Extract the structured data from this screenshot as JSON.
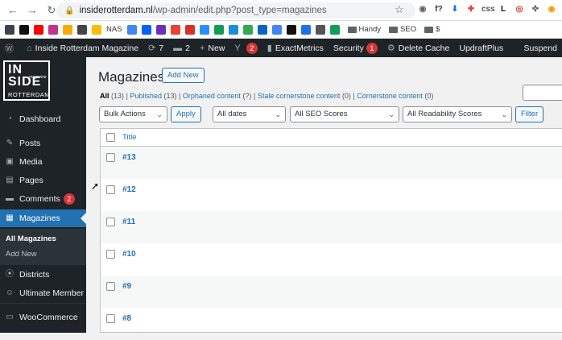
{
  "browser": {
    "url_host": "insiderotterdam.nl",
    "url_path": "/wp-admin/edit.php?post_type=magazines",
    "extensions": [
      {
        "name": "camera-icon",
        "color": "#5f6368",
        "glyph": "◉"
      },
      {
        "name": "formula-icon",
        "color": "#333333",
        "glyph": "f?"
      },
      {
        "name": "download-icon",
        "color": "#1a73e8",
        "glyph": "⬇"
      },
      {
        "name": "color-icon",
        "color": "#e94235",
        "glyph": "✚"
      },
      {
        "name": "css-icon",
        "color": "#555555",
        "glyph": "css"
      },
      {
        "name": "lastpass-icon",
        "color": "#111111",
        "glyph": "L"
      },
      {
        "name": "target-icon",
        "color": "#d93025",
        "glyph": "◎"
      },
      {
        "name": "puzzle-icon",
        "color": "#5f6368",
        "glyph": "✜"
      },
      {
        "name": "stop-icon",
        "color": "#f29900",
        "glyph": "◉"
      }
    ]
  },
  "bookmarks": {
    "items": [
      {
        "name": "wordpress-bookmark-icon",
        "color": "#3c434a"
      },
      {
        "name": "chatgpt-bookmark-icon",
        "color": "#111111"
      },
      {
        "name": "youtube-bookmark-icon",
        "color": "#ff0000"
      },
      {
        "name": "instagram-bookmark-icon",
        "color": "#c13584"
      },
      {
        "name": "analytics-bookmark-icon",
        "color": "#f9ab00"
      },
      {
        "name": "wifi-bookmark-icon",
        "color": "#444444"
      },
      {
        "name": "hand-bookmark-icon",
        "color": "#fbbc04"
      }
    ],
    "nas_label": "NAS",
    "items2": [
      {
        "name": "translate-bookmark-icon",
        "color": "#4285f4"
      },
      {
        "name": "dropbox-bookmark-icon",
        "color": "#0061ff"
      },
      {
        "name": "box-bookmark-icon",
        "color": "#6b2fba"
      },
      {
        "name": "ring-bookmark-icon",
        "color": "#e94235"
      },
      {
        "name": "acrobat-bookmark-icon",
        "color": "#d93025"
      },
      {
        "name": "z-bookmark-icon",
        "color": "#2d8cff"
      },
      {
        "name": "globe-bookmark-icon",
        "color": "#0f9d58"
      },
      {
        "name": "edge-bookmark-icon",
        "color": "#1a8fd8"
      },
      {
        "name": "photo-bookmark-icon",
        "color": "#34a853"
      },
      {
        "name": "linkedin-bookmark-icon",
        "color": "#0a66c2"
      },
      {
        "name": "bluesky-bookmark-icon",
        "color": "#4285f4"
      },
      {
        "name": "t-bookmark-icon",
        "color": "#111111"
      },
      {
        "name": "arrow-bookmark-icon",
        "color": "#1a73e8"
      },
      {
        "name": "cat-bookmark-icon",
        "color": "#555555"
      },
      {
        "name": "plus-bookmark-icon",
        "color": "#0f9d58"
      }
    ],
    "folders": [
      "Handy",
      "SEO",
      "$"
    ]
  },
  "adminbar": {
    "site_name": "Inside Rotterdam Magazine",
    "updates_count": "7",
    "comments_count": "2",
    "new_label": "New",
    "yoast_count": "2",
    "exactmetrics_label": "ExactMetrics",
    "security_label": "Security",
    "security_count": "1",
    "delete_cache_label": "Delete Cache",
    "updraft_label": "UpdraftPlus",
    "suspend_label": "Suspend"
  },
  "logo": {
    "line1": "IN",
    "line2": "SIDE",
    "tagline": "magazine",
    "line3": "ROTTERDAM"
  },
  "sidebar": {
    "items": [
      {
        "label": "Dashboard",
        "icon": "dashboard-icon"
      },
      {
        "label": "Posts",
        "icon": "pin-icon"
      },
      {
        "label": "Media",
        "icon": "media-icon"
      },
      {
        "label": "Pages",
        "icon": "pages-icon"
      },
      {
        "label": "Comments",
        "icon": "comment-icon",
        "badge": "2"
      },
      {
        "label": "Magazines",
        "icon": "book-icon"
      },
      {
        "label": "Districts",
        "icon": "location-icon"
      },
      {
        "label": "Ultimate Member",
        "icon": "users-icon"
      },
      {
        "label": "WooCommerce",
        "icon": "woo-icon"
      }
    ],
    "submenu": [
      "All Magazines",
      "Add New"
    ]
  },
  "main": {
    "title": "Magazines",
    "add_new": "Add New",
    "filters": {
      "all": "All",
      "all_count": "(13)",
      "sep": "|",
      "published": "Published",
      "published_count": "(13)",
      "orphaned": "Orphaned content",
      "orphaned_count": "(?)",
      "stale": "Stale cornerstone content",
      "stale_count": "(0)",
      "cornerstone": "Cornerstone content",
      "cornerstone_count": "(0)"
    },
    "bulk_actions": "Bulk Actions",
    "apply": "Apply",
    "dates": "All dates",
    "seo": "All SEO Scores",
    "readability": "All Readability Scores",
    "filter": "Filter",
    "column_title": "Title",
    "rows": [
      "#13",
      "#12",
      "#11",
      "#10",
      "#9",
      "#8"
    ]
  }
}
